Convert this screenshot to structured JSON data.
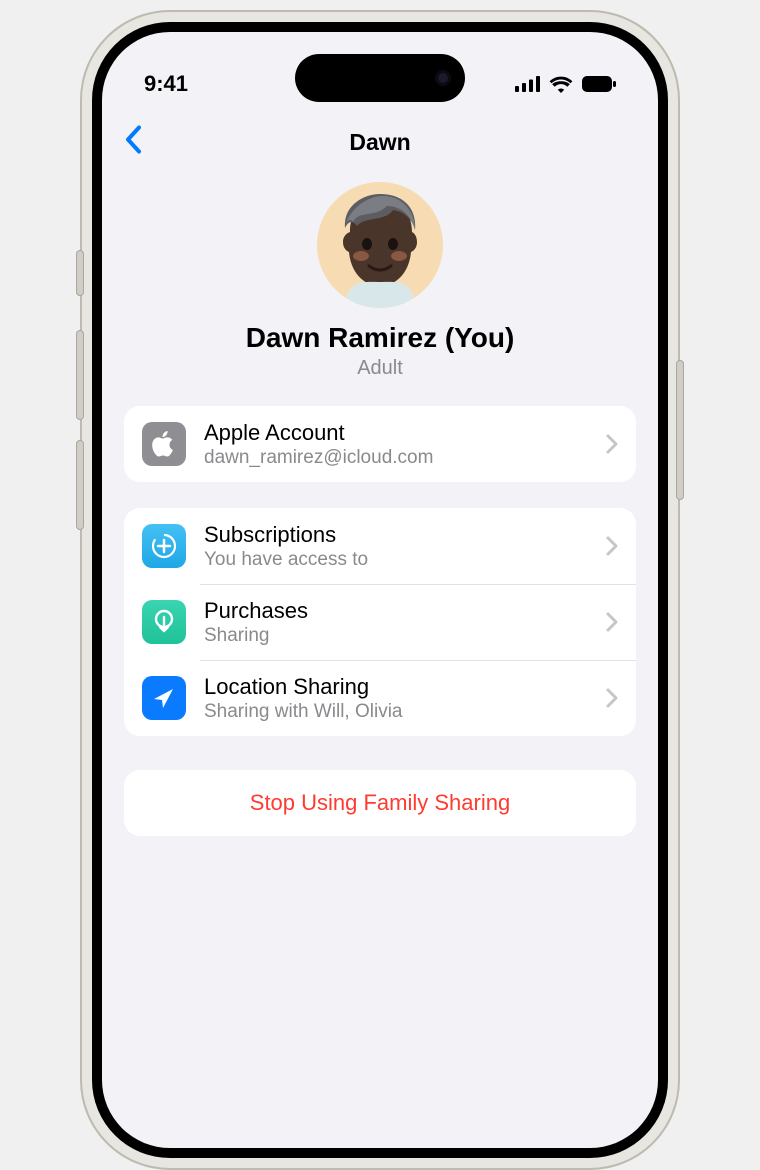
{
  "status": {
    "time": "9:41"
  },
  "nav": {
    "title": "Dawn"
  },
  "profile": {
    "name": "Dawn Ramirez (You)",
    "role": "Adult"
  },
  "account": {
    "title": "Apple Account",
    "email": "dawn_ramirez@icloud.com"
  },
  "rows": {
    "subscriptions": {
      "title": "Subscriptions",
      "sub": "You have access to"
    },
    "purchases": {
      "title": "Purchases",
      "sub": "Sharing"
    },
    "location": {
      "title": "Location Sharing",
      "sub": "Sharing with Will, Olivia"
    }
  },
  "stop": {
    "label": "Stop Using Family Sharing"
  }
}
